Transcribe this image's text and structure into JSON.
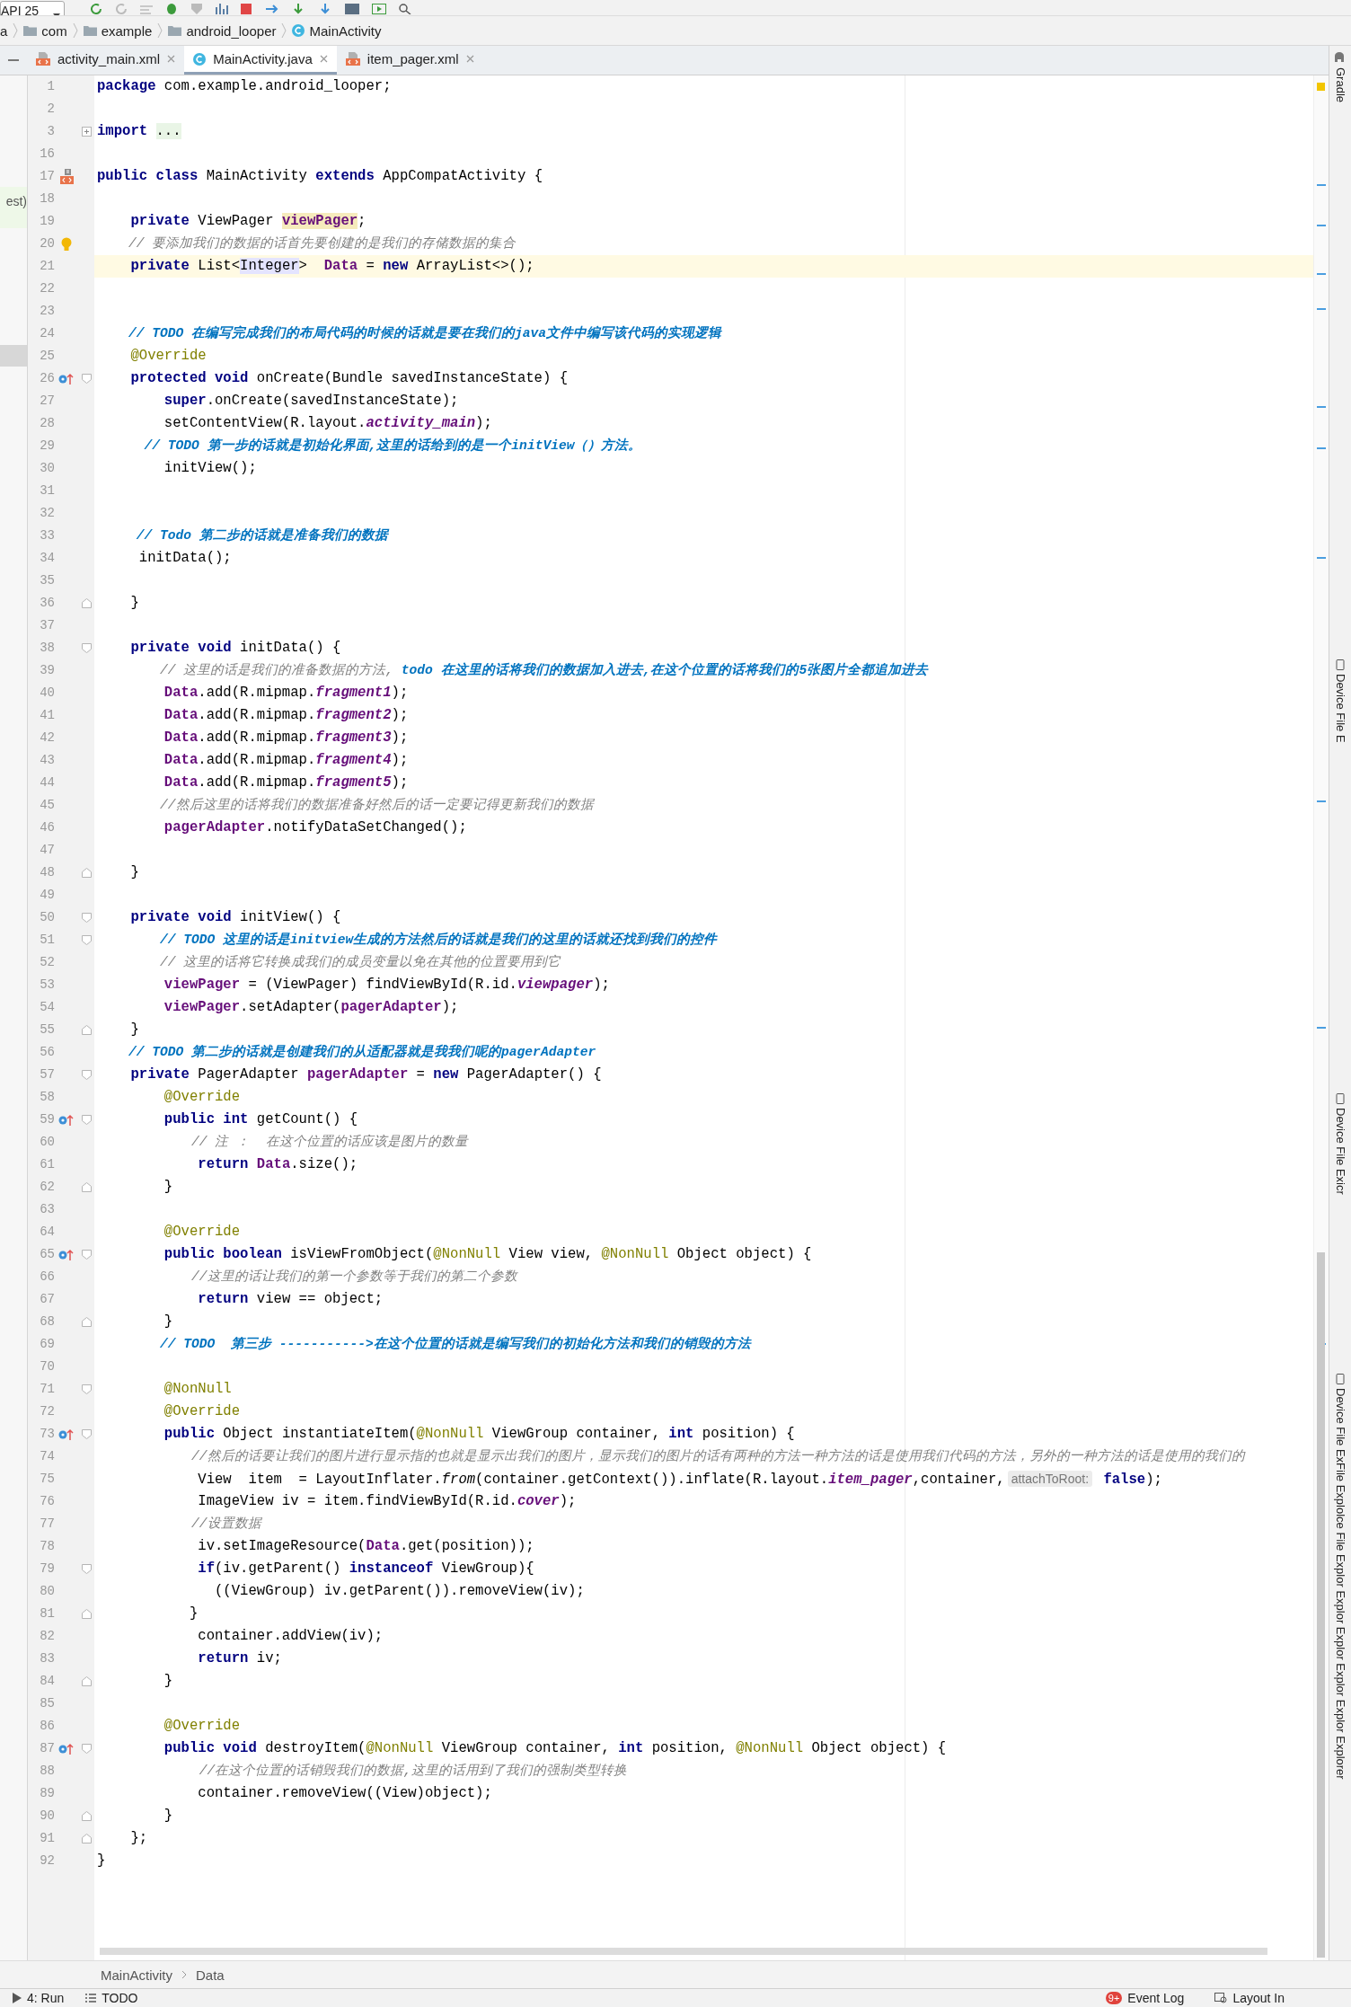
{
  "toolbar": {
    "device": "API 25"
  },
  "breadcrumb": [
    {
      "label": "a",
      "kind": "text"
    },
    {
      "label": "com",
      "kind": "folder"
    },
    {
      "label": "example",
      "kind": "folder"
    },
    {
      "label": "android_looper",
      "kind": "folder"
    },
    {
      "label": "MainActivity",
      "kind": "class"
    }
  ],
  "tabs": [
    {
      "label": "activity_main.xml",
      "kind": "xml",
      "selected": false
    },
    {
      "label": "MainActivity.java",
      "kind": "class",
      "selected": true
    },
    {
      "label": "item_pager.xml",
      "kind": "xml",
      "selected": false
    }
  ],
  "left_panel": {
    "label": "est)"
  },
  "side_tools": [
    "Gradle",
    "Device File E",
    "Device File Exicr",
    "Device File ExFile Explolce File Explor Explor Explor Explor Explor Explorer"
  ],
  "editor": {
    "lines": [
      {
        "number": "1",
        "caret_line": false,
        "tokens": [
          {
            "kind": "keyword",
            "text": "package"
          },
          {
            "kind": "plain",
            "text": " com.example.android_looper;"
          }
        ]
      },
      {
        "number": "2",
        "caret_line": false
      },
      {
        "number": "3",
        "caret_line": false,
        "fold": {
          "kind": "collapsed"
        },
        "tokens": [
          {
            "kind": "keyword",
            "text": "import "
          },
          {
            "kind": "folded",
            "text": "..."
          }
        ]
      },
      {
        "number": "16",
        "caret_line": false
      },
      {
        "number": "17",
        "caret_line": false,
        "gutter": {
          "kind": "layout"
        },
        "tokens": [
          {
            "kind": "keyword",
            "text": "public class"
          },
          {
            "kind": "plain",
            "text": " MainActivity "
          },
          {
            "kind": "keyword",
            "text": "extends"
          },
          {
            "kind": "plain",
            "text": " AppCompatActivity {"
          }
        ]
      },
      {
        "number": "18",
        "caret_line": false
      },
      {
        "number": "19",
        "caret_line": false,
        "tokens": [
          {
            "kind": "keyword",
            "text": "    private"
          },
          {
            "kind": "plain",
            "text": " ViewPager "
          },
          {
            "kind": "field_marked",
            "text": "viewPager"
          },
          {
            "kind": "plain",
            "text": ";"
          }
        ]
      },
      {
        "number": "20",
        "caret_line": false,
        "gutter": {
          "kind": "bulb"
        },
        "tokens": [
          {
            "kind": "comment",
            "text": "    // 要添加我们的数据的话首先要创建的是我们的存储数据的集合"
          }
        ]
      },
      {
        "number": "21",
        "caret_line": true,
        "tokens": [
          {
            "kind": "keyword",
            "text": "    private"
          },
          {
            "kind": "plain",
            "text": " List<"
          },
          {
            "kind": "type_marked",
            "text": "Integer"
          },
          {
            "kind": "plain",
            "text": ">  "
          },
          {
            "kind": "field",
            "text": "Data"
          },
          {
            "kind": "plain",
            "text": " = "
          },
          {
            "kind": "keyword",
            "text": "new"
          },
          {
            "kind": "plain",
            "text": " ArrayList<>();"
          }
        ]
      },
      {
        "number": "22",
        "caret_line": false
      },
      {
        "number": "23",
        "caret_line": false
      },
      {
        "number": "24",
        "caret_line": false,
        "tokens": [
          {
            "kind": "todo",
            "text": "    // TODO 在编写完成我们的布局代码的时候的话就是要在我们的java文件中编写该代码的实现逻辑"
          }
        ]
      },
      {
        "number": "25",
        "caret_line": false,
        "tokens": [
          {
            "kind": "annotation",
            "text": "    @Override"
          }
        ]
      },
      {
        "number": "26",
        "caret_line": false,
        "gutter": {
          "kind": "override"
        },
        "fold": {
          "kind": "start"
        },
        "tokens": [
          {
            "kind": "keyword",
            "text": "    protected void"
          },
          {
            "kind": "plain",
            "text": " onCreate(Bundle savedInstanceState) {"
          }
        ]
      },
      {
        "number": "27",
        "caret_line": false,
        "tokens": [
          {
            "kind": "keyword",
            "text": "        super"
          },
          {
            "kind": "plain",
            "text": ".onCreate(savedInstanceState);"
          }
        ]
      },
      {
        "number": "28",
        "caret_line": false,
        "tokens": [
          {
            "kind": "plain",
            "text": "        setContentView(R.layout."
          },
          {
            "kind": "static",
            "text": "activity_main"
          },
          {
            "kind": "plain",
            "text": ");"
          }
        ]
      },
      {
        "number": "29",
        "caret_line": false,
        "tokens": [
          {
            "kind": "todo",
            "text": "      // TODO 第一步的话就是初始化界面,这里的话给到的是一个initView（）方法。"
          }
        ]
      },
      {
        "number": "30",
        "caret_line": false,
        "tokens": [
          {
            "kind": "plain",
            "text": "        initView();"
          }
        ]
      },
      {
        "number": "31",
        "caret_line": false
      },
      {
        "number": "32",
        "caret_line": false
      },
      {
        "number": "33",
        "caret_line": false,
        "tokens": [
          {
            "kind": "todo",
            "text": "     // Todo 第二步的话就是准备我们的数据"
          }
        ]
      },
      {
        "number": "34",
        "caret_line": false,
        "tokens": [
          {
            "kind": "plain",
            "text": "     initData();"
          }
        ]
      },
      {
        "number": "35",
        "caret_line": false
      },
      {
        "number": "36",
        "caret_line": false,
        "fold": {
          "kind": "end"
        },
        "tokens": [
          {
            "kind": "plain",
            "text": "    }"
          }
        ]
      },
      {
        "number": "37",
        "caret_line": false
      },
      {
        "number": "38",
        "caret_line": false,
        "fold": {
          "kind": "start"
        },
        "tokens": [
          {
            "kind": "keyword",
            "text": "    private void"
          },
          {
            "kind": "plain",
            "text": " initData() {"
          }
        ]
      },
      {
        "number": "39",
        "caret_line": false,
        "tokens": [
          {
            "kind": "comment",
            "text": "        // 这里的话是我们的准备数据的方法,"
          },
          {
            "kind": "todo",
            "text": " todo 在这里的话将我们的数据加入进去,在这个位置的话将我们的5张图片全都追加进去"
          }
        ]
      },
      {
        "number": "40",
        "caret_line": false,
        "tokens": [
          {
            "kind": "field",
            "text": "        Data"
          },
          {
            "kind": "plain",
            "text": ".add(R.mipmap."
          },
          {
            "kind": "static",
            "text": "fragment1"
          },
          {
            "kind": "plain",
            "text": ");"
          }
        ]
      },
      {
        "number": "41",
        "caret_line": false,
        "tokens": [
          {
            "kind": "field",
            "text": "        Data"
          },
          {
            "kind": "plain",
            "text": ".add(R.mipmap."
          },
          {
            "kind": "static",
            "text": "fragment2"
          },
          {
            "kind": "plain",
            "text": ");"
          }
        ]
      },
      {
        "number": "42",
        "caret_line": false,
        "tokens": [
          {
            "kind": "field",
            "text": "        Data"
          },
          {
            "kind": "plain",
            "text": ".add(R.mipmap."
          },
          {
            "kind": "static",
            "text": "fragment3"
          },
          {
            "kind": "plain",
            "text": ");"
          }
        ]
      },
      {
        "number": "43",
        "caret_line": false,
        "tokens": [
          {
            "kind": "field",
            "text": "        Data"
          },
          {
            "kind": "plain",
            "text": ".add(R.mipmap."
          },
          {
            "kind": "static",
            "text": "fragment4"
          },
          {
            "kind": "plain",
            "text": ");"
          }
        ]
      },
      {
        "number": "44",
        "caret_line": false,
        "tokens": [
          {
            "kind": "field",
            "text": "        Data"
          },
          {
            "kind": "plain",
            "text": ".add(R.mipmap."
          },
          {
            "kind": "static",
            "text": "fragment5"
          },
          {
            "kind": "plain",
            "text": ");"
          }
        ]
      },
      {
        "number": "45",
        "caret_line": false,
        "tokens": [
          {
            "kind": "comment",
            "text": "        //然后这里的话将我们的数据准备好然后的话一定要记得更新我们的数据"
          }
        ]
      },
      {
        "number": "46",
        "caret_line": false,
        "tokens": [
          {
            "kind": "field",
            "text": "        pagerAdapter"
          },
          {
            "kind": "plain",
            "text": ".notifyDataSetChanged();"
          }
        ]
      },
      {
        "number": "47",
        "caret_line": false
      },
      {
        "number": "48",
        "caret_line": false,
        "fold": {
          "kind": "end"
        },
        "tokens": [
          {
            "kind": "plain",
            "text": "    }"
          }
        ]
      },
      {
        "number": "49",
        "caret_line": false
      },
      {
        "number": "50",
        "caret_line": false,
        "fold": {
          "kind": "start"
        },
        "tokens": [
          {
            "kind": "keyword",
            "text": "    private void"
          },
          {
            "kind": "plain",
            "text": " initView() {"
          }
        ]
      },
      {
        "number": "51",
        "caret_line": false,
        "fold": {
          "kind": "start"
        },
        "tokens": [
          {
            "kind": "todo",
            "text": "        // TODO 这里的话是initview生成的方法然后的话就是我们的这里的话就还找到我们的控件"
          }
        ]
      },
      {
        "number": "52",
        "caret_line": false,
        "tokens": [
          {
            "kind": "comment",
            "text": "        // 这里的话将它转换成我们的成员变量以免在其他的位置要用到它"
          }
        ]
      },
      {
        "number": "53",
        "caret_line": false,
        "tokens": [
          {
            "kind": "field",
            "text": "        viewPager"
          },
          {
            "kind": "plain",
            "text": " = (ViewPager) findViewById(R.id."
          },
          {
            "kind": "static",
            "text": "viewpager"
          },
          {
            "kind": "plain",
            "text": ");"
          }
        ]
      },
      {
        "number": "54",
        "caret_line": false,
        "tokens": [
          {
            "kind": "field",
            "text": "        viewPager"
          },
          {
            "kind": "plain",
            "text": ".setAdapter("
          },
          {
            "kind": "field",
            "text": "pagerAdapter"
          },
          {
            "kind": "plain",
            "text": ");"
          }
        ]
      },
      {
        "number": "55",
        "caret_line": false,
        "fold": {
          "kind": "end"
        },
        "tokens": [
          {
            "kind": "plain",
            "text": "    }"
          }
        ]
      },
      {
        "number": "56",
        "caret_line": false,
        "tokens": [
          {
            "kind": "todo",
            "text": "    // TODO 第二步的话就是创建我们的从适配器就是我我们呢的pagerAdapter"
          }
        ]
      },
      {
        "number": "57",
        "caret_line": false,
        "fold": {
          "kind": "start"
        },
        "tokens": [
          {
            "kind": "keyword",
            "text": "    private"
          },
          {
            "kind": "plain",
            "text": " PagerAdapter "
          },
          {
            "kind": "field",
            "text": "pagerAdapter"
          },
          {
            "kind": "plain",
            "text": " = "
          },
          {
            "kind": "keyword",
            "text": "new"
          },
          {
            "kind": "plain",
            "text": " PagerAdapter() {"
          }
        ]
      },
      {
        "number": "58",
        "caret_line": false,
        "tokens": [
          {
            "kind": "annotation",
            "text": "        @Override"
          }
        ]
      },
      {
        "number": "59",
        "caret_line": false,
        "gutter": {
          "kind": "override"
        },
        "fold": {
          "kind": "start"
        },
        "tokens": [
          {
            "kind": "keyword",
            "text": "        public int"
          },
          {
            "kind": "plain",
            "text": " getCount() {"
          }
        ]
      },
      {
        "number": "60",
        "caret_line": false,
        "tokens": [
          {
            "kind": "comment",
            "text": "            // 注 ：  在这个位置的话应该是图片的数量"
          }
        ]
      },
      {
        "number": "61",
        "caret_line": false,
        "tokens": [
          {
            "kind": "keyword",
            "text": "            return "
          },
          {
            "kind": "field",
            "text": "Data"
          },
          {
            "kind": "plain",
            "text": ".size();"
          }
        ]
      },
      {
        "number": "62",
        "caret_line": false,
        "fold": {
          "kind": "end"
        },
        "tokens": [
          {
            "kind": "plain",
            "text": "        }"
          }
        ]
      },
      {
        "number": "63",
        "caret_line": false
      },
      {
        "number": "64",
        "caret_line": false,
        "tokens": [
          {
            "kind": "annotation",
            "text": "        @Override"
          }
        ]
      },
      {
        "number": "65",
        "caret_line": false,
        "gutter": {
          "kind": "override"
        },
        "fold": {
          "kind": "start"
        },
        "tokens": [
          {
            "kind": "keyword",
            "text": "        public boolean"
          },
          {
            "kind": "plain",
            "text": " isViewFromObject("
          },
          {
            "kind": "annotation",
            "text": "@NonNull"
          },
          {
            "kind": "plain",
            "text": " View view, "
          },
          {
            "kind": "annotation",
            "text": "@NonNull"
          },
          {
            "kind": "plain",
            "text": " Object object) {"
          }
        ]
      },
      {
        "number": "66",
        "caret_line": false,
        "tokens": [
          {
            "kind": "comment",
            "text": "            //这里的话让我们的第一个参数等于我们的第二个参数"
          }
        ]
      },
      {
        "number": "67",
        "caret_line": false,
        "tokens": [
          {
            "kind": "keyword",
            "text": "            return"
          },
          {
            "kind": "plain",
            "text": " view == object;"
          }
        ]
      },
      {
        "number": "68",
        "caret_line": false,
        "fold": {
          "kind": "end"
        },
        "tokens": [
          {
            "kind": "plain",
            "text": "        }"
          }
        ]
      },
      {
        "number": "69",
        "caret_line": false,
        "tokens": [
          {
            "kind": "todo",
            "text": "        // TODO  第三步 ----------->在这个位置的话就是编写我们的初始化方法和我们的销毁的方法"
          }
        ]
      },
      {
        "number": "70",
        "caret_line": false
      },
      {
        "number": "71",
        "caret_line": false,
        "fold": {
          "kind": "start"
        },
        "tokens": [
          {
            "kind": "annotation",
            "text": "        @NonNull"
          }
        ]
      },
      {
        "number": "72",
        "caret_line": false,
        "tokens": [
          {
            "kind": "annotation",
            "text": "        @Override"
          }
        ]
      },
      {
        "number": "73",
        "caret_line": false,
        "gutter": {
          "kind": "override"
        },
        "fold": {
          "kind": "start"
        },
        "tokens": [
          {
            "kind": "keyword",
            "text": "        public"
          },
          {
            "kind": "plain",
            "text": " Object instantiateItem("
          },
          {
            "kind": "annotation",
            "text": "@NonNull"
          },
          {
            "kind": "plain",
            "text": " ViewGroup container, "
          },
          {
            "kind": "keyword",
            "text": "int"
          },
          {
            "kind": "plain",
            "text": " position) {"
          }
        ]
      },
      {
        "number": "74",
        "caret_line": false,
        "tokens": [
          {
            "kind": "comment",
            "text": "            //然后的话要让我们的图片进行显示指的也就是显示出我们的图片，显示我们的图片的话有两种的方法一种方法的话是使用我们代码的方法，另外的一种方法的话是使用的我们的"
          }
        ]
      },
      {
        "number": "75",
        "caret_line": false,
        "tokens": [
          {
            "kind": "plain",
            "text": "            View  item  = LayoutInflater."
          },
          {
            "kind": "italic",
            "text": "from"
          },
          {
            "kind": "plain",
            "text": "(container.getContext()).inflate(R.layout."
          },
          {
            "kind": "static",
            "text": "item_pager"
          },
          {
            "kind": "plain",
            "text": ",container,"
          },
          {
            "kind": "hint",
            "text": "attachToRoot:"
          },
          {
            "kind": "keyword",
            "text": " false"
          },
          {
            "kind": "plain",
            "text": ");"
          }
        ]
      },
      {
        "number": "76",
        "caret_line": false,
        "tokens": [
          {
            "kind": "plain",
            "text": "            ImageView iv = item.findViewById(R.id."
          },
          {
            "kind": "static",
            "text": "cover"
          },
          {
            "kind": "plain",
            "text": ");"
          }
        ]
      },
      {
        "number": "77",
        "caret_line": false,
        "tokens": [
          {
            "kind": "comment",
            "text": "            //设置数据"
          }
        ]
      },
      {
        "number": "78",
        "caret_line": false,
        "tokens": [
          {
            "kind": "plain",
            "text": "            iv.setImageResource("
          },
          {
            "kind": "field",
            "text": "Data"
          },
          {
            "kind": "plain",
            "text": ".get(position));"
          }
        ]
      },
      {
        "number": "79",
        "caret_line": false,
        "fold": {
          "kind": "start"
        },
        "tokens": [
          {
            "kind": "keyword",
            "text": "            if"
          },
          {
            "kind": "plain",
            "text": "(iv.getParent() "
          },
          {
            "kind": "keyword",
            "text": "instanceof"
          },
          {
            "kind": "plain",
            "text": " ViewGroup){"
          }
        ]
      },
      {
        "number": "80",
        "caret_line": false,
        "tokens": [
          {
            "kind": "plain",
            "text": "              ((ViewGroup) iv.getParent()).removeView(iv);"
          }
        ]
      },
      {
        "number": "81",
        "caret_line": false,
        "fold": {
          "kind": "end"
        },
        "tokens": [
          {
            "kind": "plain",
            "text": "           }"
          }
        ]
      },
      {
        "number": "82",
        "caret_line": false,
        "tokens": [
          {
            "kind": "plain",
            "text": "            container.addView(iv);"
          }
        ]
      },
      {
        "number": "83",
        "caret_line": false,
        "tokens": [
          {
            "kind": "keyword",
            "text": "            return"
          },
          {
            "kind": "plain",
            "text": " iv;"
          }
        ]
      },
      {
        "number": "84",
        "caret_line": false,
        "fold": {
          "kind": "end"
        },
        "tokens": [
          {
            "kind": "plain",
            "text": "        }"
          }
        ]
      },
      {
        "number": "85",
        "caret_line": false
      },
      {
        "number": "86",
        "caret_line": false,
        "tokens": [
          {
            "kind": "annotation",
            "text": "        @Override"
          }
        ]
      },
      {
        "number": "87",
        "caret_line": false,
        "gutter": {
          "kind": "override"
        },
        "fold": {
          "kind": "start"
        },
        "tokens": [
          {
            "kind": "keyword",
            "text": "        public void"
          },
          {
            "kind": "plain",
            "text": " destroyItem("
          },
          {
            "kind": "annotation",
            "text": "@NonNull"
          },
          {
            "kind": "plain",
            "text": " ViewGroup container, "
          },
          {
            "kind": "keyword",
            "text": "int"
          },
          {
            "kind": "plain",
            "text": " position, "
          },
          {
            "kind": "annotation",
            "text": "@NonNull"
          },
          {
            "kind": "plain",
            "text": " Object object) {"
          }
        ]
      },
      {
        "number": "88",
        "caret_line": false,
        "tokens": [
          {
            "kind": "comment",
            "text": "             //在这个位置的话销毁我们的数据,这里的话用到了我们的强制类型转换"
          }
        ]
      },
      {
        "number": "89",
        "caret_line": false,
        "tokens": [
          {
            "kind": "plain",
            "text": "            container.removeView((View)object);"
          }
        ]
      },
      {
        "number": "90",
        "caret_line": false,
        "fold": {
          "kind": "end"
        },
        "tokens": [
          {
            "kind": "plain",
            "text": "        }"
          }
        ]
      },
      {
        "number": "91",
        "caret_line": false,
        "fold": {
          "kind": "end"
        },
        "tokens": [
          {
            "kind": "plain",
            "text": "    };"
          }
        ]
      },
      {
        "number": "92",
        "caret_line": false,
        "tokens": [
          {
            "kind": "plain",
            "text": "}"
          }
        ]
      }
    ]
  },
  "structure_breadcrumb": [
    "MainActivity",
    "Data"
  ],
  "status_bar": {
    "run": "4: Run",
    "todo": "TODO",
    "event_badge": "9+",
    "event_log": "Event Log",
    "layout": "Layout In"
  }
}
